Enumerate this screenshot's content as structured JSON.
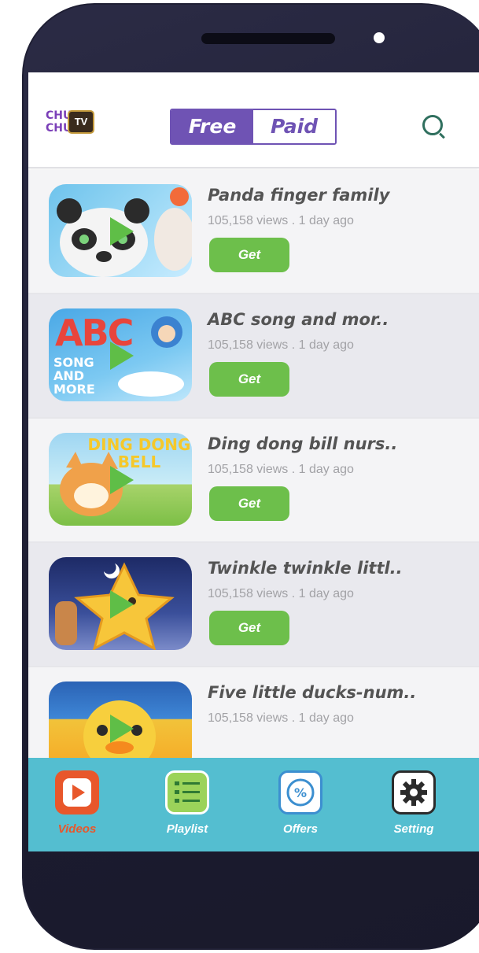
{
  "header": {
    "logo_line1": "CHU",
    "logo_line2": "CHU",
    "logo_tv": "TV",
    "toggle_free": "Free",
    "toggle_paid": "Paid",
    "search_icon": "search-icon"
  },
  "videos": [
    {
      "title": "Panda finger family",
      "meta": "105,158 views . 1 day ago",
      "button": "Get"
    },
    {
      "title": "ABC song and mor..",
      "meta": "105,158 views . 1 day ago",
      "button": "Get",
      "art_text": "ABC",
      "art_sub": "SONG AND MORE"
    },
    {
      "title": "Ding dong bill nurs..",
      "meta": "105,158 views . 1 day ago",
      "button": "Get",
      "art_text": "DING DONG BELL"
    },
    {
      "title": "Twinkle twinkle littl..",
      "meta": "105,158 views . 1 day ago",
      "button": "Get"
    },
    {
      "title": "Five little ducks-num..",
      "meta": "105,158 views . 1 day ago"
    }
  ],
  "nav": [
    {
      "label": "Videos",
      "icon": "play-icon",
      "active": true,
      "color": "#e8572b"
    },
    {
      "label": "Playlist",
      "icon": "playlist-icon",
      "color": "#9bd35a"
    },
    {
      "label": "Offers",
      "icon": "offers-icon",
      "color": "#3c8fd0"
    },
    {
      "label": "Setting",
      "icon": "gear-icon",
      "color": "#2b2b2b"
    }
  ],
  "colors": {
    "accent": "#6f53b4",
    "get_button": "#6dbf4b",
    "bottom_nav": "#54bed0",
    "phone_frame": "#1f1f34"
  }
}
